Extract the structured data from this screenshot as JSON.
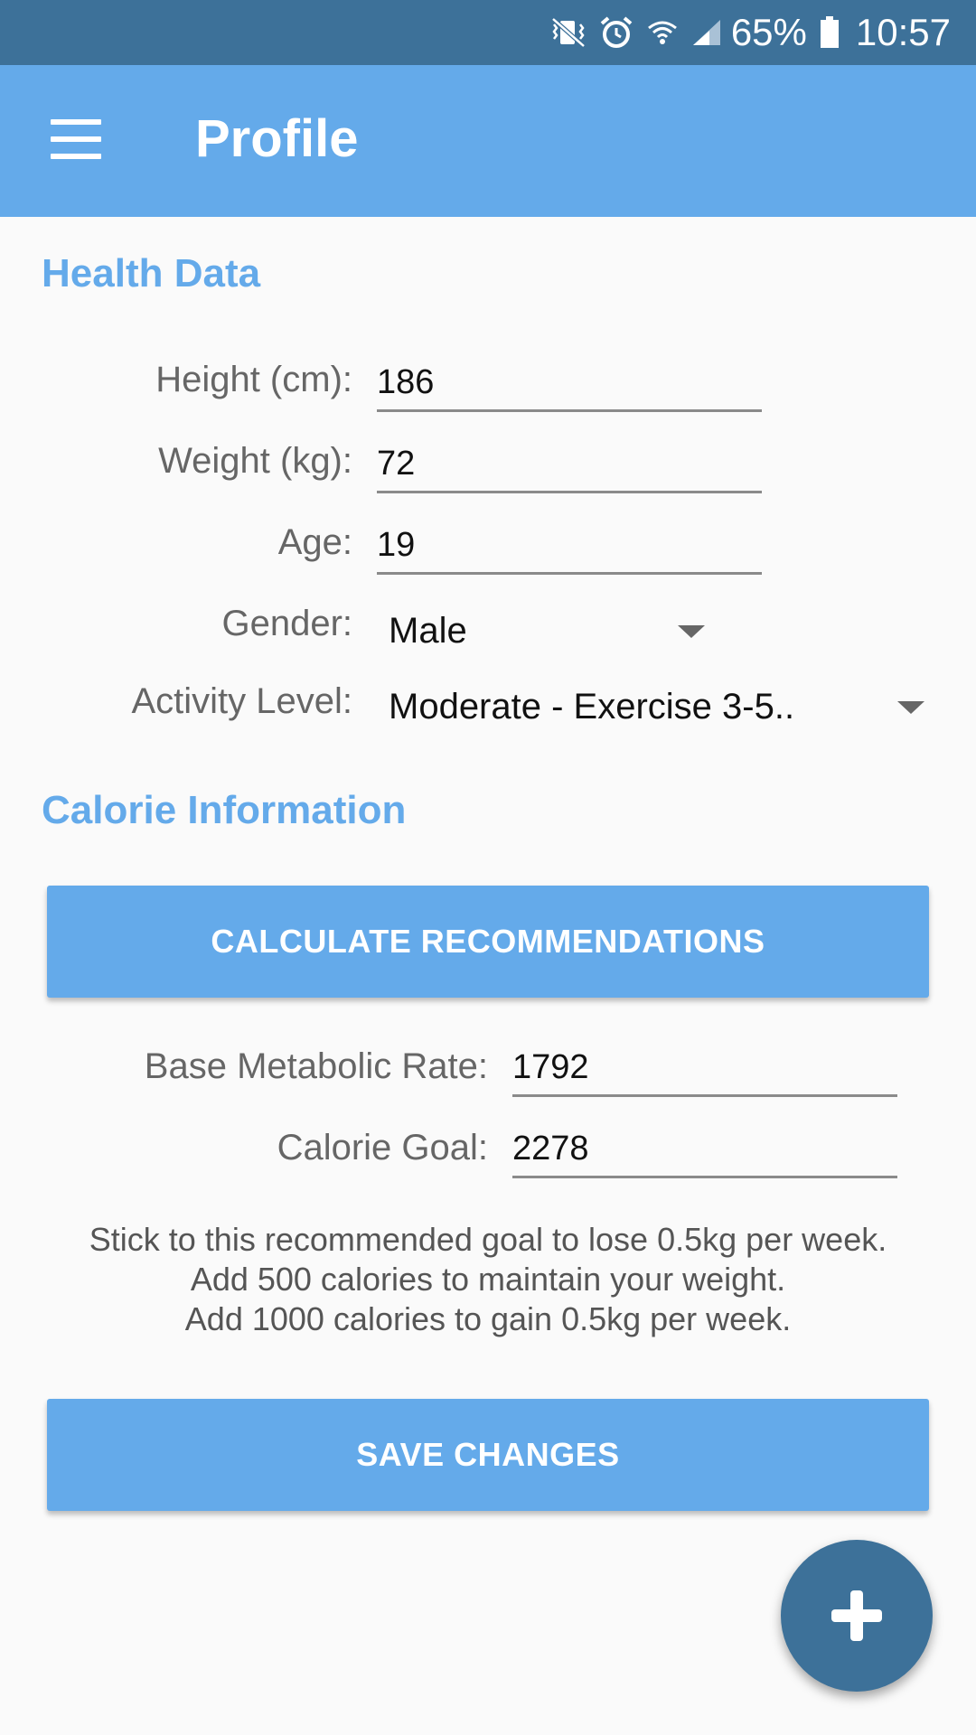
{
  "status_bar": {
    "battery_percent": "65%",
    "time": "10:57",
    "icons": [
      "vibrate-mute-icon",
      "alarm-icon",
      "wifi-icon",
      "signal-icon",
      "battery-icon"
    ]
  },
  "app_bar": {
    "title": "Profile",
    "menu_icon": "hamburger-menu-icon"
  },
  "health_data": {
    "heading": "Health Data",
    "height": {
      "label": "Height (cm):",
      "value": "186"
    },
    "weight": {
      "label": "Weight (kg):",
      "value": "72"
    },
    "age": {
      "label": "Age:",
      "value": "19"
    },
    "gender": {
      "label": "Gender:",
      "selected": "Male"
    },
    "activity": {
      "label": "Activity Level:",
      "selected": "Moderate - Exercise 3-5.."
    }
  },
  "calorie_info": {
    "heading": "Calorie Information",
    "calculate_button": "CALCULATE RECOMMENDATIONS",
    "bmr": {
      "label": "Base Metabolic Rate:",
      "value": "1792"
    },
    "goal": {
      "label": "Calorie Goal:",
      "value": "2278"
    },
    "note_lines": [
      "Stick to this recommended goal to lose 0.5kg per week.",
      "Add 500 calories to maintain your weight.",
      "Add 1000 calories to gain 0.5kg per week."
    ],
    "save_button": "SAVE CHANGES"
  },
  "fab": {
    "icon": "plus-icon"
  },
  "colors": {
    "primary": "#64aaea",
    "primary_dark": "#3d7199",
    "background": "#fafafa"
  }
}
